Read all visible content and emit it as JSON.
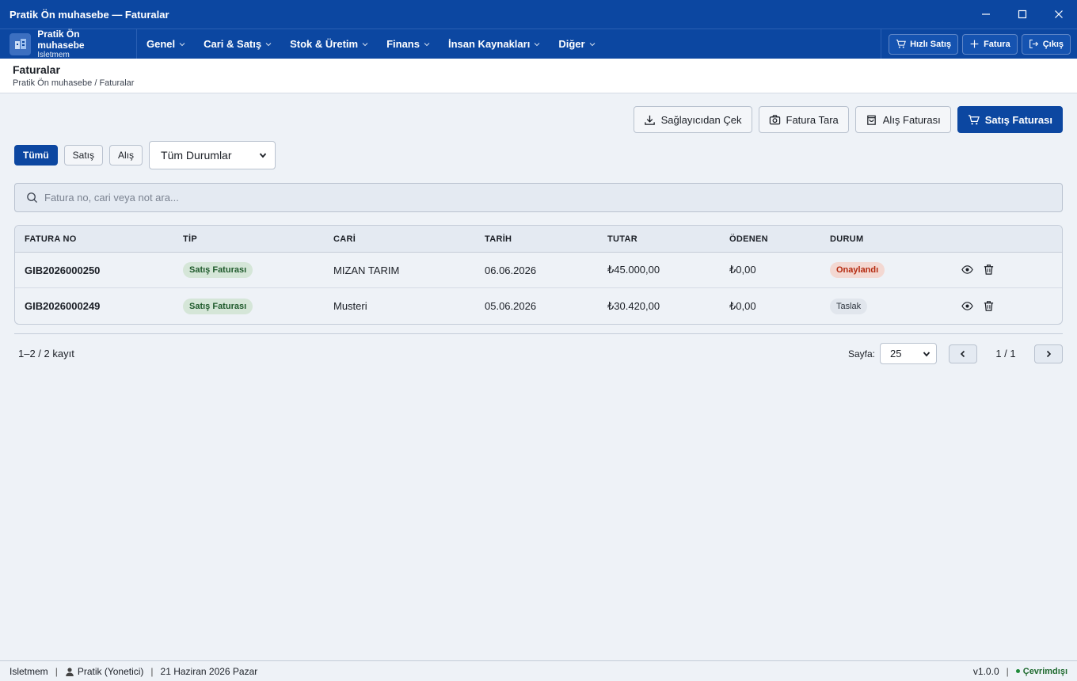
{
  "window": {
    "title": "Pratik Ön muhasebe — Faturalar"
  },
  "brand": {
    "name": "Pratik Ön muhasebe",
    "sub": "Isletmem"
  },
  "menu": [
    "Genel",
    "Cari & Satış",
    "Stok & Üretim",
    "Finans",
    "İnsan Kaynakları",
    "Diğer"
  ],
  "nav_actions": {
    "quick_sale": "Hızlı Satış",
    "invoice": "Fatura",
    "logout": "Çıkış"
  },
  "page": {
    "title": "Faturalar",
    "breadcrumb": "Pratik Ön muhasebe / Faturalar"
  },
  "actions": {
    "fetch": "Sağlayıcıdan Çek",
    "scan": "Fatura Tara",
    "purchase": "Alış Faturası",
    "sales": "Satış Faturası"
  },
  "filters": {
    "all": "Tümü",
    "sales": "Satış",
    "purchase": "Alış",
    "status_select": "Tüm Durumlar"
  },
  "search": {
    "placeholder": "Fatura no, cari veya not ara..."
  },
  "table": {
    "headers": [
      "FATURA NO",
      "TİP",
      "CARİ",
      "TARİH",
      "TUTAR",
      "ÖDENEN",
      "DURUM"
    ],
    "rows": [
      {
        "no": "GIB2026000250",
        "type": "Satış Faturası",
        "customer": "MIZAN TARIM",
        "date": "06.06.2026",
        "amount": "₺45.000,00",
        "paid": "₺0,00",
        "status": "Onaylandı"
      },
      {
        "no": "GIB2026000249",
        "type": "Satış Faturası",
        "customer": "Musteri",
        "date": "05.06.2026",
        "amount": "₺30.420,00",
        "paid": "₺0,00",
        "status": "Taslak"
      }
    ]
  },
  "pagination": {
    "count": "1–2 / 2 kayıt",
    "page_label": "Sayfa:",
    "page_size": "25",
    "page_info": "1 / 1"
  },
  "statusbar": {
    "company": "Isletmem",
    "user": "Pratik (Yonetici)",
    "date": "21 Haziran 2026 Pazar",
    "version": "v1.0.0",
    "connection": "Çevrimdışı"
  },
  "colors": {
    "primary": "#0c47a1",
    "background": "#eef2f7",
    "approved_badge": "#b42a10",
    "sales_badge": "#1f5a2c",
    "online_dot": "#1f8a3a"
  }
}
